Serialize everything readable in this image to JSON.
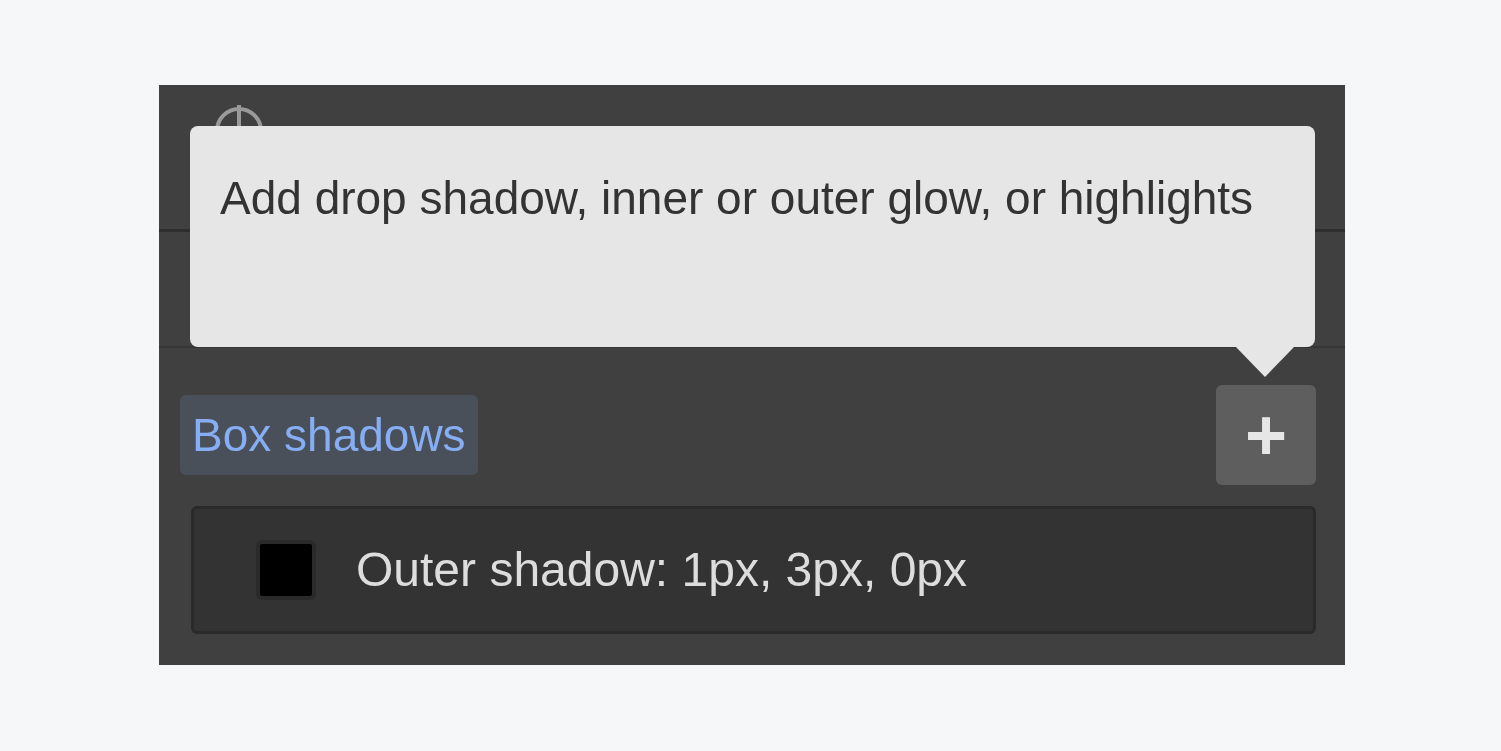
{
  "tooltip": {
    "text": "Add drop shadow, inner or outer glow, or highlights"
  },
  "section": {
    "label": "Box shadows",
    "add_button": "+"
  },
  "shadows": [
    {
      "label": "Outer shadow: 1px, 3px, 0px",
      "color": "#000000"
    }
  ]
}
